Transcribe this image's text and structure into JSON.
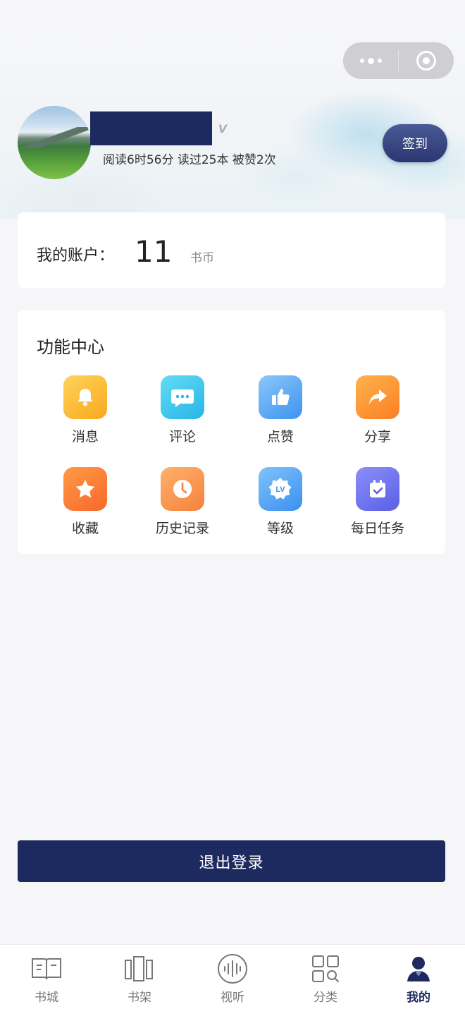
{
  "status_bar": {
    "left": "",
    "right": ""
  },
  "capsule": {
    "more": "more-icon",
    "close": "target-icon"
  },
  "profile": {
    "stats": "阅读6时56分 读过25本 被赞2次",
    "vip_badge": "V",
    "signin_label": "签到"
  },
  "account": {
    "label": "我的账户：",
    "balance": "11",
    "unit": "书币"
  },
  "func_center": {
    "title": "功能中心",
    "items": [
      {
        "label": "消息",
        "icon": "bell-icon",
        "color": "#f7a91d"
      },
      {
        "label": "评论",
        "icon": "comment-icon",
        "color": "#27b5e8"
      },
      {
        "label": "点赞",
        "icon": "thumbs-up-icon",
        "color": "#3d93ef"
      },
      {
        "label": "分享",
        "icon": "share-icon",
        "color": "#fb7f22"
      },
      {
        "label": "收藏",
        "icon": "star-icon",
        "color": "#f8682a"
      },
      {
        "label": "历史记录",
        "icon": "clock-icon",
        "color": "#f4823c"
      },
      {
        "label": "等级",
        "icon": "level-icon",
        "color": "#3b8ff0"
      },
      {
        "label": "每日任务",
        "icon": "calendar-check-icon",
        "color": "#5a5fe6"
      }
    ]
  },
  "logout_label": "退出登录",
  "tabbar": {
    "tabs": [
      {
        "label": "书城",
        "icon": "bookstore-icon"
      },
      {
        "label": "书架",
        "icon": "bookshelf-icon"
      },
      {
        "label": "视听",
        "icon": "audio-icon"
      },
      {
        "label": "分类",
        "icon": "category-icon"
      },
      {
        "label": "我的",
        "icon": "profile-icon",
        "active": true
      }
    ]
  },
  "colors": {
    "primary": "#1c2a5f",
    "background": "#f6f6f8"
  }
}
